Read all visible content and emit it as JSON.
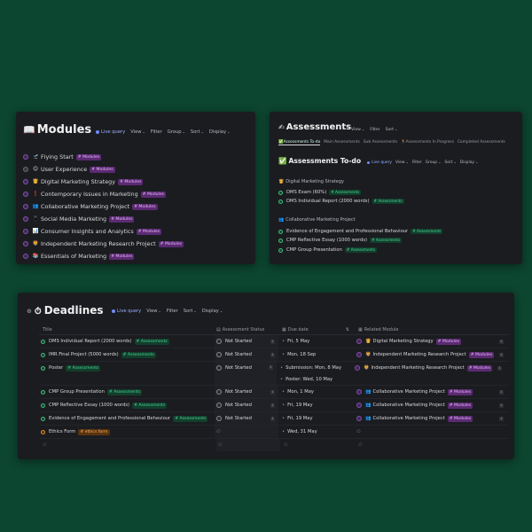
{
  "modules": {
    "icon": "book-icon",
    "title": "Modules",
    "toolbar": {
      "live_query": "Live query",
      "view": "View",
      "filter": "Filter",
      "group": "Group",
      "sort": "Sort",
      "display": "Display"
    },
    "items": [
      {
        "emoji": "🛫",
        "label": "Flying Start",
        "tag": "# Modules"
      },
      {
        "emoji": "😊",
        "label": "User Experience",
        "tag": "# Modules"
      },
      {
        "emoji": "👸",
        "label": "Digital Marketing Strategy",
        "tag": "# Modules"
      },
      {
        "emoji": "❗",
        "label": "Contemporary Issues in Marketing",
        "tag": "# Modules"
      },
      {
        "emoji": "👥",
        "label": "Collaborative Marketing Project",
        "tag": "# Modules"
      },
      {
        "emoji": "📱",
        "label": "Social Media Marketing",
        "tag": "# Modules"
      },
      {
        "emoji": "📊",
        "label": "Consumer Insights and Analytics",
        "tag": "# Modules"
      },
      {
        "emoji": "🦁",
        "label": "Independent Marketing Research Project",
        "tag": "# Modules"
      },
      {
        "emoji": "📚",
        "label": "Essentials of Marketing",
        "tag": "# Modules"
      }
    ]
  },
  "assessments": {
    "title": "Assessments",
    "toolbar": {
      "view": "View",
      "filter": "Filter",
      "sort": "Sort"
    },
    "tabs": [
      "Assessments To-do",
      "Main Assessments",
      "Sub Assessments",
      "Assessments In Progress",
      "Completed Assessments"
    ],
    "todo_title": "Assessments To-do",
    "todo_toolbar": {
      "live_query": "Live query",
      "view": "View",
      "filter": "Filter",
      "group": "Group",
      "sort": "Sort",
      "display": "Display"
    },
    "groups": [
      {
        "name": "Digital Marketing Strategy",
        "items": [
          {
            "label": "DMS Exam (60%)",
            "tag": "# Assessments"
          },
          {
            "label": "DMS Individual Report (2000 words)",
            "tag": "# Assessments"
          }
        ]
      },
      {
        "name": "Collaborative Marketing Project",
        "items": [
          {
            "label": "Evidence of Engagement and Professional Behaviour",
            "tag": "# Assessments"
          },
          {
            "label": "CMP Reflective Essay (1000 words)",
            "tag": "# Assessments"
          },
          {
            "label": "CMP Group Presentation",
            "tag": "# Assessments"
          }
        ]
      }
    ]
  },
  "deadlines": {
    "title": "Deadlines",
    "toolbar": {
      "live_query": "Live query",
      "view": "View",
      "filter": "Filter",
      "sort": "Sort",
      "display": "Display"
    },
    "columns": [
      "Title",
      "Assessment Status",
      "Due date",
      "Related Module"
    ],
    "rows": [
      {
        "title": "DMS Individual Report (2000 words)",
        "tag": "# Assessments",
        "status": "Not Started",
        "due": [
          "Fri, 5 May"
        ],
        "module": "Digital Marketing Strategy",
        "module_emoji": "👸"
      },
      {
        "title": "IMR Final Project (5000 words)",
        "tag": "# Assessments",
        "status": "Not Started",
        "due": [
          "Mon, 18 Sep"
        ],
        "module": "Independent Marketing Research Project",
        "module_emoji": "🦁"
      },
      {
        "title": "Poster",
        "tag": "# Assessments",
        "status": "Not Started",
        "due": [
          "Submission: Mon, 8 May",
          "Poster: Wed, 10 May"
        ],
        "module": "Independent Marketing Research Project",
        "module_emoji": "🦁"
      },
      {
        "title": "CMP Group Presentation",
        "tag": "# Assessments",
        "status": "Not Started",
        "due": [
          "Mon, 1 May"
        ],
        "module": "Collaborative Marketing Project",
        "module_emoji": "👥"
      },
      {
        "title": "CMP Reflective Essay (1000 words)",
        "tag": "# Assessments",
        "status": "Not Started",
        "due": [
          "Fri, 19 May"
        ],
        "module": "Collaborative Marketing Project",
        "module_emoji": "👥"
      },
      {
        "title": "Evidence of Engagement and Professional Behaviour",
        "tag": "# Assessments",
        "status": "Not Started",
        "due": [
          "Fri, 19 May"
        ],
        "module": "Collaborative Marketing Project",
        "module_emoji": "👥"
      },
      {
        "title": "Ethics Form",
        "tag": "# ethics form",
        "status": "",
        "due": [
          "Wed, 31 May"
        ],
        "module": "",
        "module_emoji": ""
      }
    ],
    "empty_placeholder": "∅",
    "colors": {
      "modules_tag": "#5b2a72",
      "assessments_tag": "#113f2c",
      "ethics_tag": "#5a3410"
    }
  }
}
